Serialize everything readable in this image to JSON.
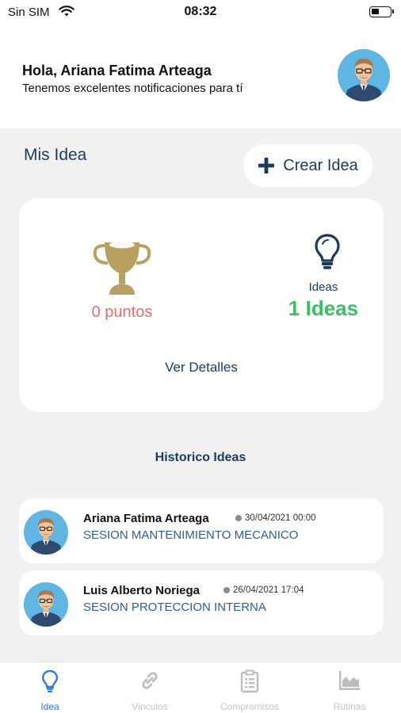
{
  "status_bar": {
    "carrier": "Sin SIM",
    "time": "08:32"
  },
  "header": {
    "greeting": "Hola, Ariana Fatima Arteaga",
    "subtitle": "Tenemos excelentes notificaciones para tí"
  },
  "section": {
    "title": "Mis Idea",
    "create_button": "Crear Idea"
  },
  "summary": {
    "points": "0 puntos",
    "ideas_label": "Ideas",
    "ideas_count": "1 Ideas",
    "details_link": "Ver Detalles"
  },
  "history": {
    "title": "Historico Ideas",
    "items": [
      {
        "name": "Ariana Fatima Arteaga",
        "date": "30/04/2021 00:00",
        "description": "SESION MANTENIMIENTO MECANICO"
      },
      {
        "name": "Luis Alberto Noriega",
        "date": "26/04/2021 17:04",
        "description": "SESION PROTECCION INTERNA"
      }
    ]
  },
  "tabs": [
    {
      "label": "Idea",
      "icon": "lightbulb-icon",
      "active": true
    },
    {
      "label": "Vinculos",
      "icon": "link-icon",
      "active": false
    },
    {
      "label": "Compromisos",
      "icon": "clipboard-icon",
      "active": false
    },
    {
      "label": "Rutinas",
      "icon": "bar-chart-icon",
      "active": false
    }
  ],
  "colors": {
    "primary_dark": "#1c3a5a",
    "accent_link": "#2d5f95",
    "points_red": "#ee6b6b",
    "ideas_green": "#3bbf63",
    "trophy_gold": "#b8a061",
    "tab_active": "#2a7ce0",
    "background": "#f1f1f1"
  }
}
